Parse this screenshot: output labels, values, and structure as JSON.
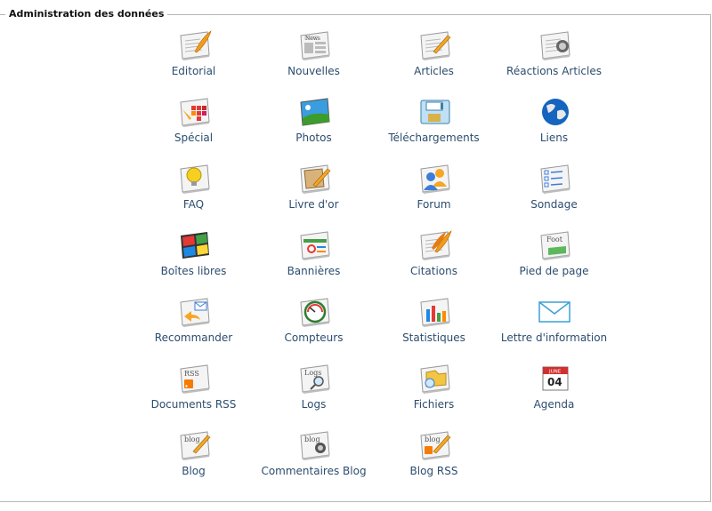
{
  "section": {
    "title": "Administration des données"
  },
  "items": [
    {
      "label": "Editorial",
      "icon": "quill-document-icon"
    },
    {
      "label": "Nouvelles",
      "icon": "newspaper-icon"
    },
    {
      "label": "Articles",
      "icon": "article-pen-icon"
    },
    {
      "label": "Réactions Articles",
      "icon": "article-comments-icon"
    },
    {
      "label": "Spécial",
      "icon": "special-palette-icon"
    },
    {
      "label": "Photos",
      "icon": "photo-landscape-icon"
    },
    {
      "label": "Téléchargements",
      "icon": "download-disk-icon"
    },
    {
      "label": "Liens",
      "icon": "globe-icon"
    },
    {
      "label": "FAQ",
      "icon": "lightbulb-icon"
    },
    {
      "label": "Livre d'or",
      "icon": "guestbook-icon"
    },
    {
      "label": "Forum",
      "icon": "users-icon"
    },
    {
      "label": "Sondage",
      "icon": "poll-checklist-icon"
    },
    {
      "label": "Boîtes libres",
      "icon": "window-blocks-icon"
    },
    {
      "label": "Bannières",
      "icon": "banner-icon"
    },
    {
      "label": "Citations",
      "icon": "quote-quill-icon"
    },
    {
      "label": "Pied de page",
      "icon": "footer-icon"
    },
    {
      "label": "Recommander",
      "icon": "recommend-mail-icon"
    },
    {
      "label": "Compteurs",
      "icon": "counter-gauge-icon"
    },
    {
      "label": "Statistiques",
      "icon": "statistics-chart-icon"
    },
    {
      "label": "Lettre d'information",
      "icon": "newsletter-envelope-icon"
    },
    {
      "label": "Documents RSS",
      "icon": "rss-document-icon"
    },
    {
      "label": "Logs",
      "icon": "logs-magnifier-icon"
    },
    {
      "label": "Fichiers",
      "icon": "files-folder-icon"
    },
    {
      "label": "Agenda",
      "icon": "calendar-icon"
    },
    {
      "label": "Blog",
      "icon": "blog-pen-icon"
    },
    {
      "label": "Commentaires Blog",
      "icon": "blog-comments-icon"
    },
    {
      "label": "Blog RSS",
      "icon": "blog-rss-icon"
    }
  ],
  "icon_texts": {
    "Nouvelles": "News",
    "Pied de page": "Foot",
    "Documents RSS": "RSS",
    "Logs": "Logs",
    "Agenda_month": "JUNE",
    "Agenda_day": "04",
    "Blog": "blog",
    "Commentaires Blog": "blog",
    "Blog RSS": "blog"
  }
}
